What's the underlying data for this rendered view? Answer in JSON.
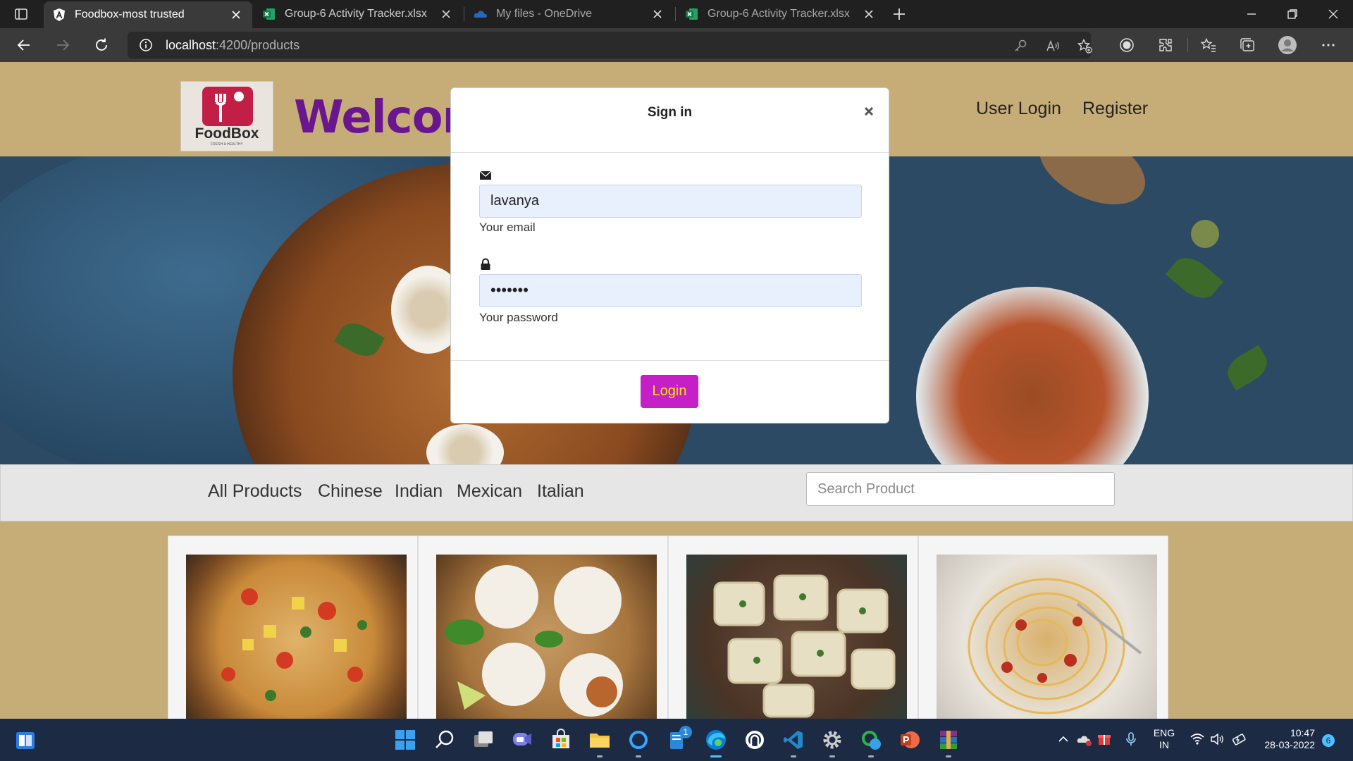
{
  "browser": {
    "tabs": [
      {
        "label": "Foodbox-most trusted",
        "icon": "angular-icon",
        "active": true
      },
      {
        "label": "Group-6 Activity Tracker.xlsx",
        "icon": "excel-icon",
        "active": false
      },
      {
        "label": "My files - OneDrive",
        "icon": "onedrive-icon",
        "active": false
      },
      {
        "label": "Group-6 Activity Tracker.xlsx",
        "icon": "excel-icon",
        "active": false
      }
    ],
    "url_host": "localhost",
    "url_path": ":4200/products"
  },
  "site": {
    "logo_text": "FoodBox",
    "logo_sub": "FRESH & HEALTHY",
    "welcome": "Welcome",
    "nav": {
      "user_login": "User Login",
      "register": "Register"
    },
    "categories": [
      "All Products",
      "Chinese",
      "Indian",
      "Mexican",
      "Italian"
    ],
    "search_placeholder": "Search Product"
  },
  "modal": {
    "title": "Sign in",
    "email_value": "lavanya",
    "email_help": "Your email",
    "password_value": "•••••••",
    "password_help": "Your password",
    "login_label": "Login"
  },
  "taskbar": {
    "lang_top": "ENG",
    "lang_bottom": "IN",
    "time": "10:47",
    "date": "28-03-2022",
    "notifications": "6",
    "badge_count": "1"
  },
  "colors": {
    "page_bg": "#c6ad78",
    "welcome": "#6a168f",
    "login_btn": "#c71fc7",
    "login_text": "#ffea00"
  }
}
